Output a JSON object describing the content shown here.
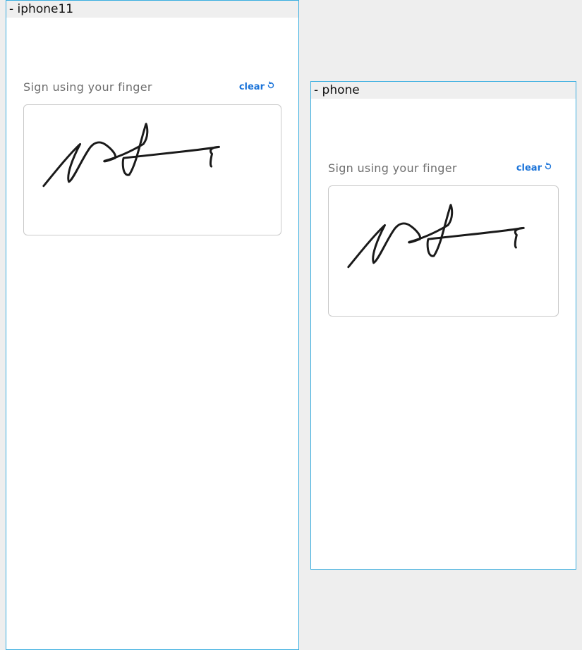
{
  "frames": [
    {
      "title": "- iphone11",
      "instruction": "Sign using your finger",
      "clear_label": "clear",
      "clear_icon": "refresh-icon"
    },
    {
      "title": "- phone",
      "instruction": "Sign using your finger",
      "clear_label": "clear",
      "clear_icon": "refresh-icon"
    }
  ],
  "colors": {
    "accent": "#1a73d9",
    "frame_border": "#3aaee0",
    "ink": "#1a1a1a"
  }
}
